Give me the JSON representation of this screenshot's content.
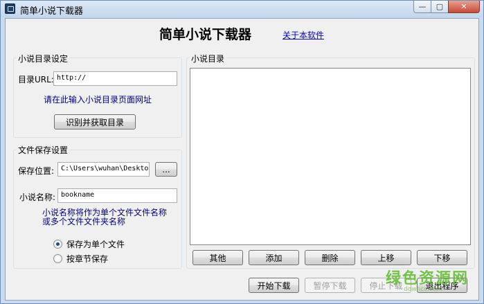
{
  "window": {
    "title": "简单小说下载器",
    "controls": {
      "minimize": "—",
      "maximize": "▢",
      "close": "✕"
    }
  },
  "header": {
    "title": "简单小说下载器",
    "about_link": "关于本软件"
  },
  "catalog_settings": {
    "group_title": "小说目录设定",
    "url_label": "目录URL:",
    "url_value": "http://",
    "hint": "请在此输入小说目录页面网址",
    "fetch_button": "识别并获取目录"
  },
  "file_settings": {
    "group_title": "文件保存设置",
    "path_label": "保存位置:",
    "path_value": "C:\\Users\\wuhan\\Desktop",
    "browse_button": "...",
    "name_label": "小说名称:",
    "name_value": "bookname",
    "hint_line1": "小说名称将作为单个文件文件名称",
    "hint_line2": "或多个文件文件夹名称",
    "radio_single": "保存为单个文件",
    "radio_chapter": "按章节保存",
    "selected": "single"
  },
  "directory": {
    "group_title": "小说目录",
    "items": [],
    "buttons": {
      "other": "其他",
      "add": "添加",
      "delete": "删除",
      "move_up": "上移",
      "move_down": "下移"
    }
  },
  "actions": {
    "start": "开始下载",
    "pause": "暂停下载",
    "stop": "停止下载",
    "exit": "退出程序"
  },
  "watermark": {
    "text": "绿色资源网",
    "url": "downcc.com"
  }
}
